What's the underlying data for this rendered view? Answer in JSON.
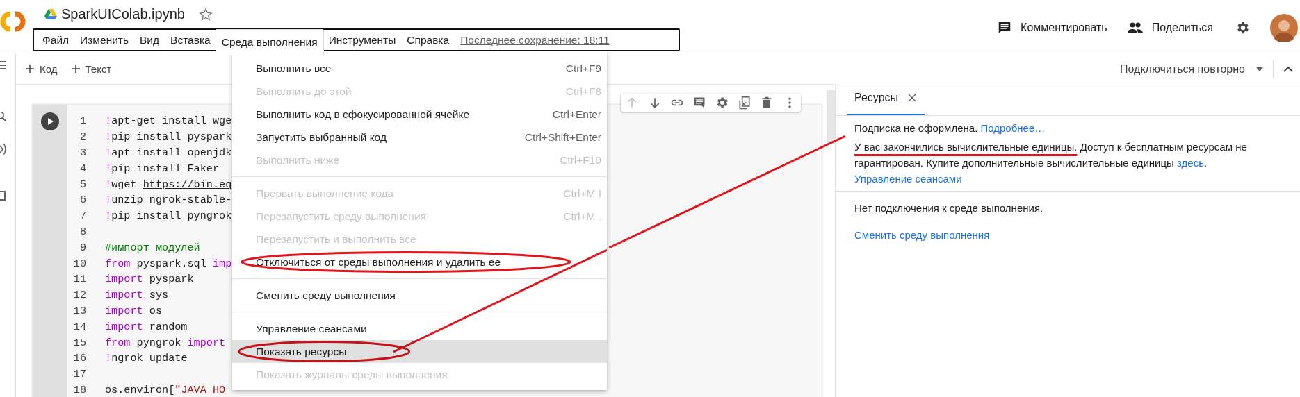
{
  "notebook": {
    "title": "SparkUIColab.ipynb",
    "starred": false
  },
  "menu_bar": [
    {
      "label": "Файл",
      "selected": false
    },
    {
      "label": "Изменить",
      "selected": false
    },
    {
      "label": "Вид",
      "selected": false
    },
    {
      "label": "Вставка",
      "selected": false
    },
    {
      "label": "Среда выполнения",
      "selected": true
    },
    {
      "label": "Инструменты",
      "selected": false
    },
    {
      "label": "Справка",
      "selected": false
    }
  ],
  "last_saved": "Последнее сохранение: 18:11",
  "header_actions": [
    {
      "kind": "comment",
      "label": "Комментировать"
    },
    {
      "kind": "share",
      "label": "Поделиться"
    }
  ],
  "toolbar": {
    "add_buttons": [
      {
        "label": "Код"
      },
      {
        "label": "Текст"
      }
    ],
    "connect": "Подключиться повторно"
  },
  "cell_toolbar": [
    {
      "kind": "up",
      "disabled": true
    },
    {
      "kind": "down",
      "disabled": false
    },
    {
      "kind": "link",
      "disabled": false
    },
    {
      "kind": "comment",
      "disabled": false
    },
    {
      "kind": "settings",
      "disabled": false
    },
    {
      "kind": "mirror",
      "disabled": false
    },
    {
      "kind": "delete",
      "disabled": false
    },
    {
      "kind": "more",
      "disabled": false
    }
  ],
  "cell": {
    "lines": [
      {
        "number": "1",
        "tokens": [
          {
            "kind": "bang",
            "text": "!"
          },
          {
            "kind": "plain",
            "text": "apt-get install wge"
          }
        ]
      },
      {
        "number": "2",
        "tokens": [
          {
            "kind": "bang",
            "text": "!"
          },
          {
            "kind": "plain",
            "text": "pip install pyspark"
          }
        ]
      },
      {
        "number": "3",
        "tokens": [
          {
            "kind": "bang",
            "text": "!"
          },
          {
            "kind": "plain",
            "text": "apt install openjdk"
          }
        ]
      },
      {
        "number": "4",
        "tokens": [
          {
            "kind": "bang",
            "text": "!"
          },
          {
            "kind": "plain",
            "text": "pip install Faker"
          }
        ]
      },
      {
        "number": "5",
        "tokens": [
          {
            "kind": "bang",
            "text": "!"
          },
          {
            "kind": "plain",
            "text": "wget "
          },
          {
            "kind": "url",
            "text": "https://bin.eq"
          }
        ]
      },
      {
        "number": "6",
        "tokens": [
          {
            "kind": "bang",
            "text": "!"
          },
          {
            "kind": "plain",
            "text": "unzip ngrok-stable-"
          }
        ]
      },
      {
        "number": "7",
        "tokens": [
          {
            "kind": "bang",
            "text": "!"
          },
          {
            "kind": "plain",
            "text": "pip install pyngrok"
          }
        ]
      },
      {
        "number": "8"
      },
      {
        "number": "9",
        "tokens": [
          {
            "kind": "comment",
            "text": "#импорт модулей"
          }
        ]
      },
      {
        "number": "10",
        "tokens": [
          {
            "kind": "keyword",
            "text": "from"
          },
          {
            "kind": "plain",
            "text": " pyspark.sql "
          },
          {
            "kind": "keyword",
            "text": "imp"
          }
        ]
      },
      {
        "number": "11",
        "tokens": [
          {
            "kind": "keyword",
            "text": "import"
          },
          {
            "kind": "plain",
            "text": " pyspark"
          }
        ]
      },
      {
        "number": "12",
        "tokens": [
          {
            "kind": "keyword",
            "text": "import"
          },
          {
            "kind": "plain",
            "text": " sys"
          }
        ]
      },
      {
        "number": "13",
        "tokens": [
          {
            "kind": "keyword",
            "text": "import"
          },
          {
            "kind": "plain",
            "text": " os"
          }
        ]
      },
      {
        "number": "14",
        "tokens": [
          {
            "kind": "keyword",
            "text": "import"
          },
          {
            "kind": "plain",
            "text": " random"
          }
        ]
      },
      {
        "number": "15",
        "tokens": [
          {
            "kind": "keyword",
            "text": "from"
          },
          {
            "kind": "plain",
            "text": " pyngrok "
          },
          {
            "kind": "keyword",
            "text": "import"
          }
        ]
      },
      {
        "number": "16",
        "tokens": [
          {
            "kind": "bang",
            "text": "!"
          },
          {
            "kind": "plain",
            "text": "ngrok update"
          }
        ]
      },
      {
        "number": "17"
      },
      {
        "number": "18",
        "tokens": [
          {
            "kind": "plain",
            "text": "os.environ["
          },
          {
            "kind": "string",
            "text": "\"JAVA_HO"
          }
        ]
      }
    ]
  },
  "dropdown": [
    {
      "kind": "item",
      "label": "Выполнить все",
      "shortcut": "Ctrl+F9",
      "disabled": false,
      "selected": false,
      "circled": false
    },
    {
      "kind": "item",
      "label": "Выполнить до этой",
      "shortcut": "Ctrl+F8",
      "disabled": true,
      "selected": false,
      "circled": false
    },
    {
      "kind": "item",
      "label": "Выполнить код в сфокусированной ячейке",
      "shortcut": "Ctrl+Enter",
      "disabled": false,
      "selected": false,
      "circled": false
    },
    {
      "kind": "item",
      "label": "Запустить выбранный код",
      "shortcut": "Ctrl+Shift+Enter",
      "disabled": false,
      "selected": false,
      "circled": false
    },
    {
      "kind": "item",
      "label": "Выполнить ниже",
      "shortcut": "Ctrl+F10",
      "disabled": true,
      "selected": false,
      "circled": false
    },
    {
      "kind": "divider"
    },
    {
      "kind": "item",
      "label": "Прервать выполнение кода",
      "shortcut": "Ctrl+M I",
      "disabled": true,
      "selected": false,
      "circled": false
    },
    {
      "kind": "item",
      "label": "Перезапустить среду выполнения",
      "shortcut": "Ctrl+M .",
      "disabled": true,
      "selected": false,
      "circled": false
    },
    {
      "kind": "item",
      "label": "Перезапустить и выполнить все",
      "disabled": true,
      "selected": false,
      "circled": false
    },
    {
      "kind": "item",
      "label": "Отключиться от среды выполнения и удалить ее",
      "disabled": false,
      "selected": false,
      "circled": true
    },
    {
      "kind": "divider"
    },
    {
      "kind": "item",
      "label": "Сменить среду выполнения",
      "disabled": false,
      "selected": false,
      "circled": false
    },
    {
      "kind": "divider"
    },
    {
      "kind": "item",
      "label": "Управление сеансами",
      "disabled": false,
      "selected": false,
      "circled": false
    },
    {
      "kind": "item",
      "label": "Показать ресурсы",
      "disabled": false,
      "selected": true,
      "circled": true
    },
    {
      "kind": "item",
      "label": "Показать журналы среды выполнения",
      "disabled": true,
      "selected": false,
      "circled": false
    }
  ],
  "resources_panel": {
    "tab": {
      "label": "Ресурсы",
      "selected": true
    },
    "subscription": {
      "text": "Подписка не оформлена.",
      "link": "Подробнее…"
    },
    "compute": {
      "highlight": "У вас закончились вычислительные единицы.",
      "text": " Доступ к бесплатным ресурсам не гарантирован. Купите дополнительные вычислительные единицы ",
      "link": "здесь",
      "after": "."
    },
    "sessions_link": "Управление сеансами",
    "status": "Нет подключения к среде выполнения.",
    "change_link": "Сменить среду выполнения"
  }
}
